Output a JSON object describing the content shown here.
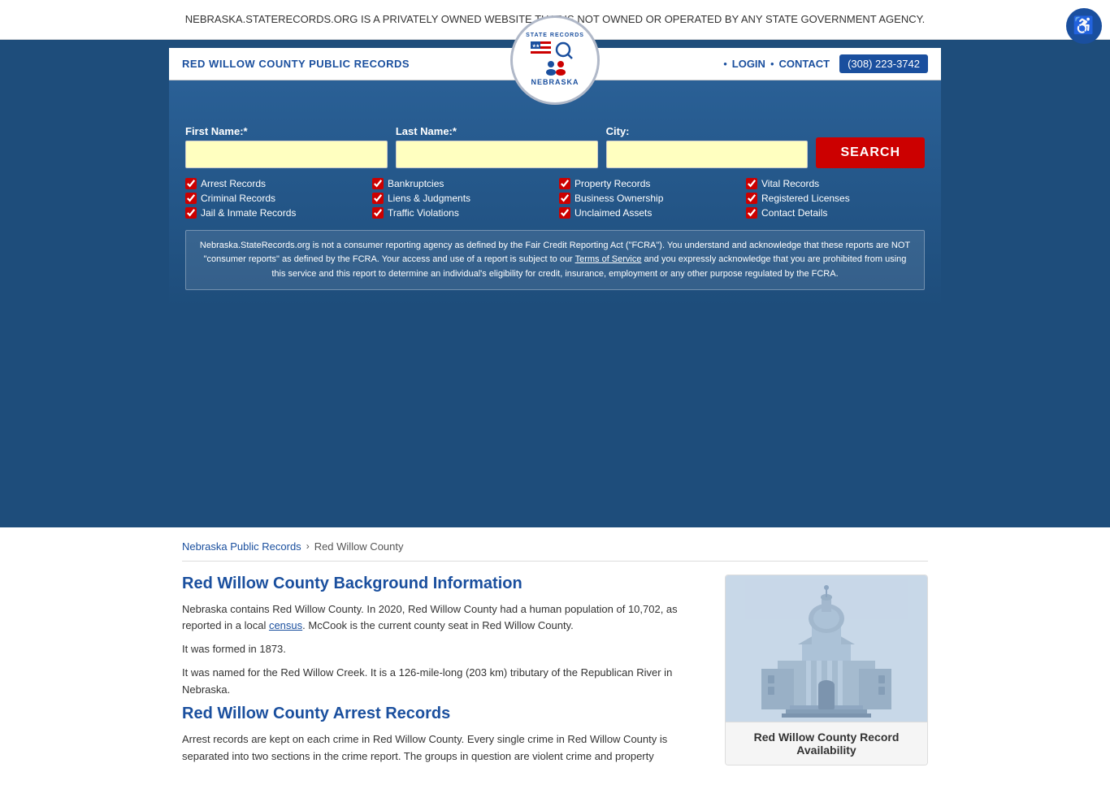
{
  "banner": {
    "text": "NEBRASKA.STATERECORDS.ORG IS A PRIVATELY OWNED WEBSITE THAT IS NOT OWNED OR OPERATED BY ANY STATE GOVERNMENT AGENCY.",
    "close_label": "×"
  },
  "accessibility": {
    "label": "♿"
  },
  "header": {
    "site_title": "RED WILLOW COUNTY PUBLIC RECORDS",
    "nav": {
      "login": "LOGIN",
      "contact": "CONTACT",
      "phone": "(308) 223-3742"
    }
  },
  "logo": {
    "arc_top": "STATE RECORDS",
    "icons": "🔍👥",
    "state": "NEBRASKA"
  },
  "search": {
    "first_name_label": "First Name:*",
    "last_name_label": "Last Name:*",
    "city_label": "City:",
    "first_name_placeholder": "",
    "last_name_placeholder": "",
    "city_placeholder": "",
    "button_label": "SEARCH"
  },
  "checkboxes": [
    {
      "label": "Arrest Records",
      "checked": true
    },
    {
      "label": "Bankruptcies",
      "checked": true
    },
    {
      "label": "Property Records",
      "checked": true
    },
    {
      "label": "Vital Records",
      "checked": true
    },
    {
      "label": "Criminal Records",
      "checked": true
    },
    {
      "label": "Liens & Judgments",
      "checked": true
    },
    {
      "label": "Business Ownership",
      "checked": true
    },
    {
      "label": "Registered Licenses",
      "checked": true
    },
    {
      "label": "Jail & Inmate Records",
      "checked": true
    },
    {
      "label": "Traffic Violations",
      "checked": true
    },
    {
      "label": "Unclaimed Assets",
      "checked": true
    },
    {
      "label": "Contact Details",
      "checked": true
    }
  ],
  "disclaimer": {
    "text_before": "Nebraska.StateRecords.org is not a consumer reporting agency as defined by the Fair Credit Reporting Act (\"FCRA\"). You understand and acknowledge that these reports are NOT \"consumer reports\" as defined by the FCRA. Your access and use of a report is subject to our ",
    "link_text": "Terms of Service",
    "text_after": " and you expressly acknowledge that you are prohibited from using this service and this report to determine an individual's eligibility for credit, insurance, employment or any other purpose regulated by the FCRA."
  },
  "breadcrumb": {
    "home": "Nebraska Public Records",
    "separator": "›",
    "current": "Red Willow County"
  },
  "main_content": {
    "section1_title": "Red Willow County Background Information",
    "section1_p1": "Nebraska contains Red Willow County. In 2020, Red Willow County had a human population of 10,702, as reported in a local ",
    "section1_link": "census",
    "section1_p1_end": ". McCook is the current county seat in Red Willow County.",
    "section1_p2": "It was formed in 1873.",
    "section1_p3": "It was named for the Red Willow Creek. It is a 126-mile-long (203 km) tributary of the Republican River in Nebraska.",
    "section2_title": "Red Willow County Arrest Records",
    "section2_p1": "Arrest records are kept on each crime in Red Willow County. Every single crime in Red Willow County is separated into two sections in the crime report. The groups in question are violent crime and property"
  },
  "sidebar": {
    "card_title": "Red Willow County Record Availability"
  }
}
